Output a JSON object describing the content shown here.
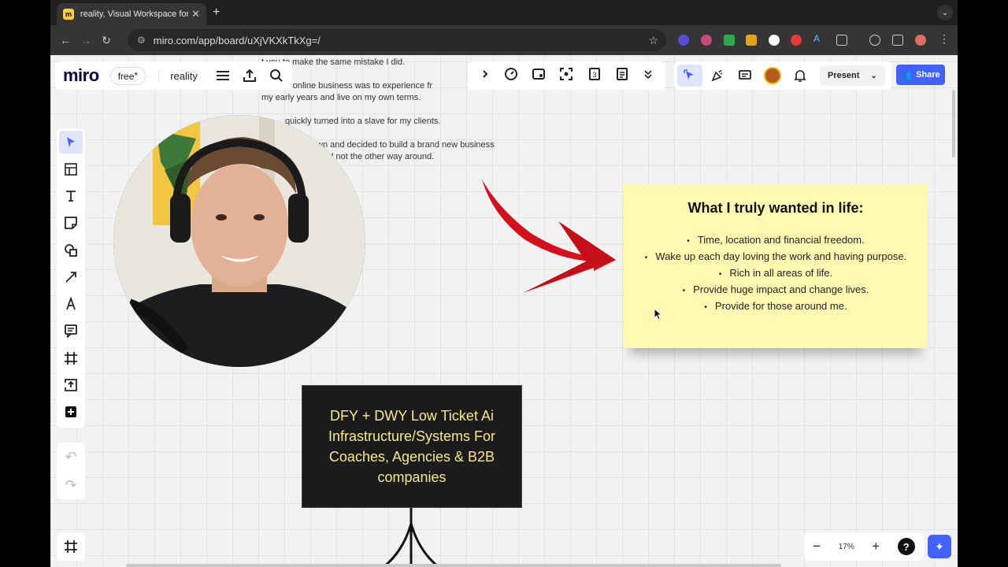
{
  "browser": {
    "tab_title": "reality, Visual Workspace for Innovation",
    "url": "miro.com/app/board/uXjVKXkTkXg=/"
  },
  "miro": {
    "logo": "miro",
    "plan_badge": "free",
    "board_name": "reality",
    "present_label": "Present",
    "share_label": "Share",
    "zoom_level": "17%"
  },
  "board": {
    "doc_lines": [
      "t you to make the same mistake I did.",
      "start an online business was to experience fr",
      "my early years and live on my own terms.",
      "quickly turned into a slave for my clients.",
      "wn and decided to build a brand new business",
      "nted not the other way around."
    ],
    "sticky": {
      "title": "What I truly wanted in life:",
      "items": [
        "Time, location and financial freedom.",
        "Wake up each day loving the work and having purpose.",
        "Rich in all areas of life.",
        "Provide huge impact and change lives.",
        "Provide for those around me."
      ]
    },
    "dark_box_text": "DFY + DWY Low Ticket Ai Infrastructure/Systems For Coaches, Agencies & B2B companies"
  },
  "colors": {
    "board_bg": "#f2f2f2",
    "sticky": "#fff9b1",
    "accent": "#4262ff",
    "arrow": "#d4101c",
    "dark_box": "#1b1b1b",
    "dark_box_text": "#f6e986"
  }
}
